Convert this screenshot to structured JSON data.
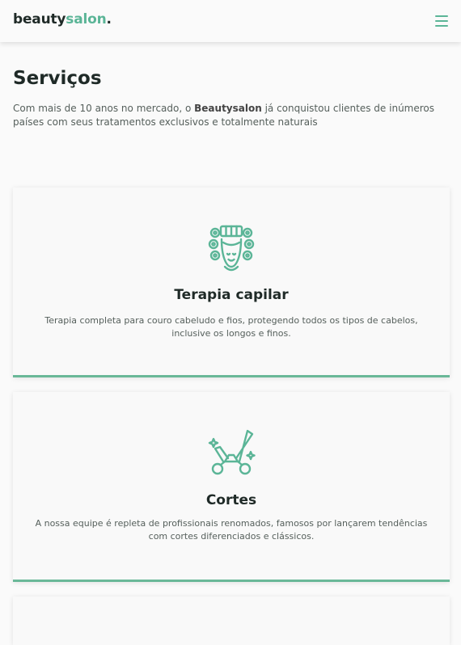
{
  "header": {
    "logo_part1": "beauty",
    "logo_part2": "salon",
    "logo_part3": ".",
    "menu_icon": "hamburger-menu-icon"
  },
  "colors": {
    "accent": "#5bb597",
    "text_dark": "#1f2a27",
    "text_muted": "#555f5b",
    "background": "#fafafa"
  },
  "services": {
    "title": "Serviços",
    "desc_before": "Com mais de 10 anos no mercado, o ",
    "desc_brand": "Beautysalon",
    "desc_after": " já conquistou clientes de inúmeros países com seus tratamentos exclusivos e totalmente naturais",
    "cards": [
      {
        "icon": "hair-rollers-icon",
        "title": "Terapia capilar",
        "description": "Terapia completa para couro cabeludo e fios, protegendo todos os tipos de cabelos, inclusive os longos e finos."
      },
      {
        "icon": "scissors-icon",
        "title": "Cortes",
        "description": "A nossa equipe é repleta de profissionais renomados, famosos por lançarem tendências com cortes diferenciados e clássicos."
      }
    ]
  }
}
